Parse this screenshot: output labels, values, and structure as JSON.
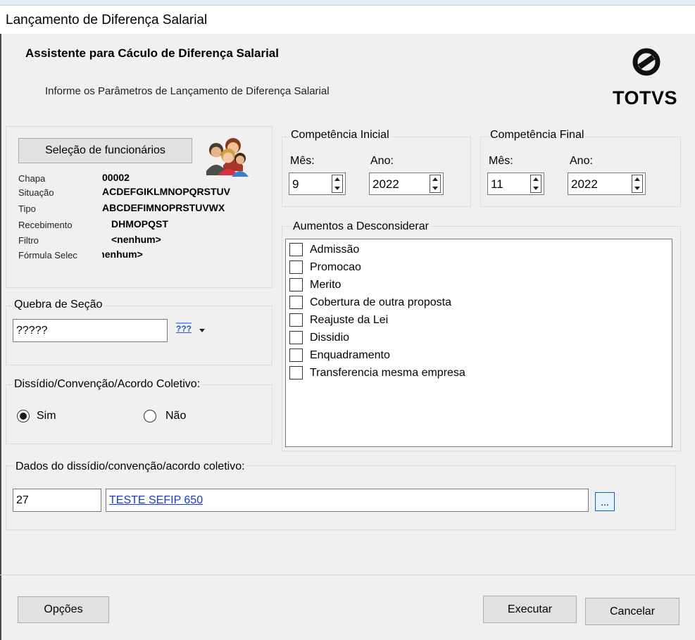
{
  "window": {
    "title": "Lançamento de Diferença Salarial"
  },
  "header": {
    "title": "Assistente para Cáculo de Diferença Salarial",
    "subtitle": "Informe os Parâmetros de Lançamento de Diferença Salarial",
    "brand": "TOTVS",
    "logo_icon": "totvs-logo-icon"
  },
  "employee_selection": {
    "button_label": "Seleção de funcionários",
    "icon": "users-icon",
    "fields": [
      {
        "label": "Chapa",
        "value": "00002"
      },
      {
        "label": "Situação",
        "value": "ACDEFGIKLMNOPQRSTUV"
      },
      {
        "label": "Tipo",
        "value": "ABCDEFIMNOPRSTUVWX"
      },
      {
        "label": "Recebimento",
        "value": "DHMOPQST"
      },
      {
        "label": "Filtro",
        "value": "<nenhum>"
      },
      {
        "label": "Fórmula Selec",
        "value": "<nenhum>"
      }
    ]
  },
  "section_break": {
    "legend": "Quebra de Seção",
    "value": "?????",
    "dropdown_label": "???"
  },
  "collective_agreement": {
    "legend": "Dissídio/Convenção/Acordo Coletivo:",
    "options": [
      {
        "label": "Sim",
        "selected": true
      },
      {
        "label": "Não",
        "selected": false
      }
    ]
  },
  "initial_competence": {
    "legend": "Competência Inicial",
    "month_label": "Mês:",
    "month": "9",
    "year_label": "Ano:",
    "year": "2022"
  },
  "final_competence": {
    "legend": "Competência Final",
    "month_label": "Mês:",
    "month": "11",
    "year_label": "Ano:",
    "year": "2022"
  },
  "exclusions": {
    "legend": "Aumentos a Desconsiderar",
    "items": [
      {
        "label": "Admissão",
        "checked": false
      },
      {
        "label": "Promocao",
        "checked": false
      },
      {
        "label": "Merito",
        "checked": false
      },
      {
        "label": "Cobertura de outra proposta",
        "checked": false
      },
      {
        "label": "Reajuste da Lei",
        "checked": false
      },
      {
        "label": "Dissidio",
        "checked": false
      },
      {
        "label": "Enquadramento",
        "checked": false
      },
      {
        "label": "Transferencia mesma empresa",
        "checked": false
      }
    ]
  },
  "agreement_data": {
    "legend": "Dados do dissídio/convenção/acordo coletivo:",
    "code": "27",
    "description": "TESTE SEFIP 650",
    "lookup_label": "..."
  },
  "footer": {
    "options_label": "Opções",
    "execute_label": "Executar",
    "cancel_label": "Cancelar"
  },
  "colors": {
    "link": "#1a3acf",
    "lookup_border": "#0a64c8",
    "background": "#f0f0f0"
  }
}
